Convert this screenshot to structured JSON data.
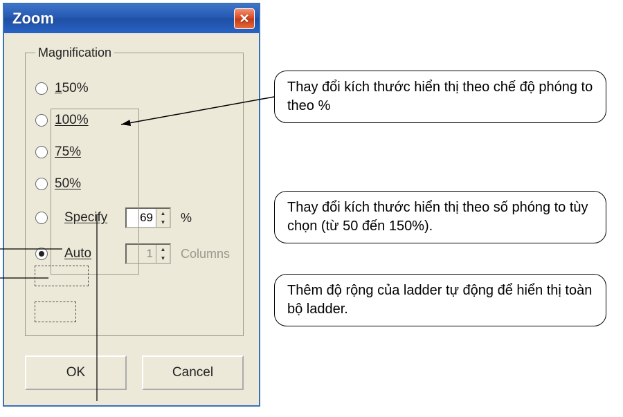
{
  "dialog": {
    "title": "Zoom",
    "group_label": "Magnification",
    "options": {
      "p150": "150%",
      "p100": "100%",
      "p75": "75%",
      "p50": "50%",
      "specify": "Specify",
      "auto": "Auto"
    },
    "specify_value": "69",
    "specify_unit": "%",
    "auto_value": "1",
    "auto_unit": "Columns",
    "ok": "OK",
    "cancel": "Cancel"
  },
  "callouts": {
    "c1": "Thay đổi kích thước hiển thị theo chế độ phóng to theo %",
    "c2": "Thay đổi kích thước hiển thị theo số phóng to tùy chọn (từ 50 đến 150%).",
    "c3": "Thêm độ rộng của ladder tự động để hiển thị toàn bộ ladder."
  }
}
